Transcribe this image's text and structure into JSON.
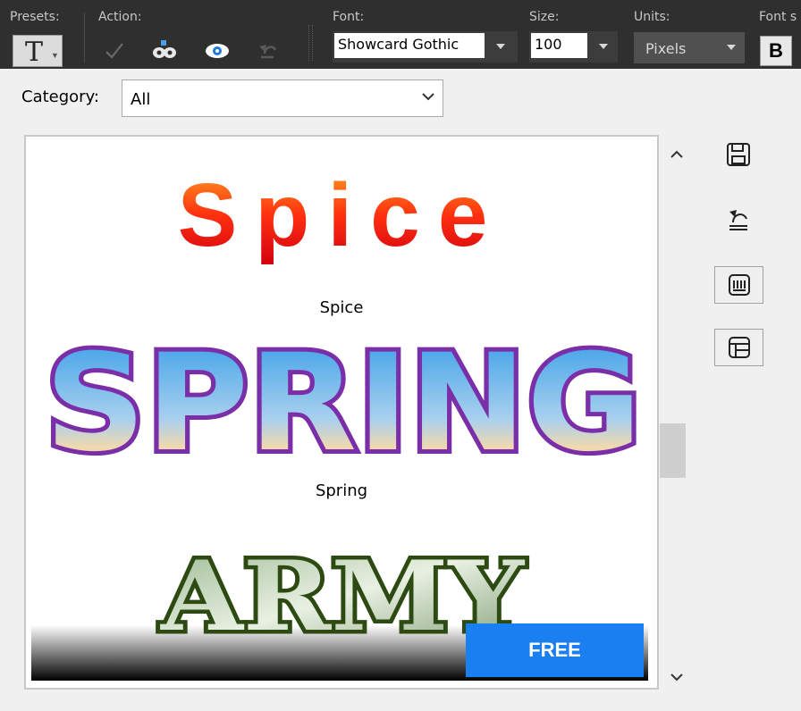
{
  "toolbar": {
    "presets_label": "Presets:",
    "action_label": "Action:",
    "font_label": "Font:",
    "size_label": "Size:",
    "units_label": "Units:",
    "font_style_label": "Font s",
    "presets_glyph": "T",
    "font_value": "Showcard Gothic",
    "size_value": "100",
    "units_value": "Pixels",
    "bold_label": "B",
    "actions": [
      "check-icon",
      "mask-icon",
      "eye-icon",
      "undo-icon"
    ]
  },
  "category": {
    "label": "Category:",
    "selected": "All"
  },
  "presets": [
    {
      "preview_text": "Spice",
      "caption": "Spice"
    },
    {
      "preview_text": "SPRING",
      "caption": "Spring"
    },
    {
      "preview_text": "ARMY",
      "caption": ""
    }
  ],
  "free_button": "FREE",
  "side_buttons": [
    "save-icon",
    "reset-icon",
    "preset-icon-1",
    "preset-icon-2"
  ],
  "colors": {
    "toolbar_bg": "#2f2f2f",
    "panel_bg": "#f0f0f0",
    "free_bg": "#1a7ff0",
    "spring_stroke": "#7a2ea8",
    "army_stroke": "#2c4a12"
  }
}
